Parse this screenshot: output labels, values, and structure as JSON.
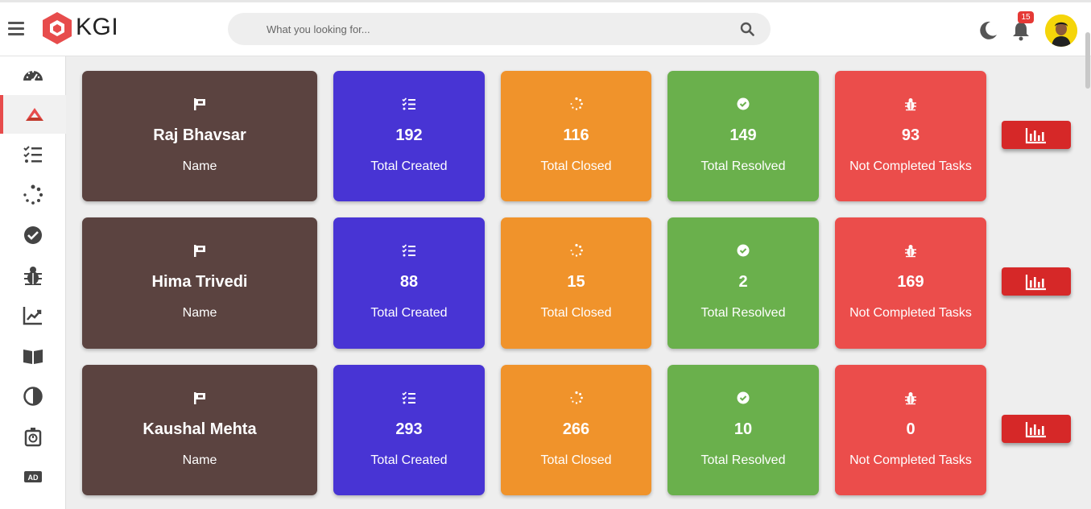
{
  "app": {
    "logo_text": "KGI"
  },
  "search": {
    "placeholder": "What you looking for..."
  },
  "header": {
    "notification_count": "15"
  },
  "sidebar": {
    "items": [
      {
        "icon": "speedometer-icon"
      },
      {
        "icon": "logo-mark-icon",
        "active": true
      },
      {
        "icon": "task-list-icon"
      },
      {
        "icon": "spinner-icon"
      },
      {
        "icon": "check-circle-icon"
      },
      {
        "icon": "bug-icon"
      },
      {
        "icon": "trend-chart-icon"
      },
      {
        "icon": "book-icon"
      },
      {
        "icon": "contrast-icon"
      },
      {
        "icon": "timer-icon"
      },
      {
        "icon": "ad-icon"
      }
    ]
  },
  "colors": {
    "name_card": "#5b4340",
    "created_card": "#4834d4",
    "closed_card": "#f0932b",
    "resolved_card": "#6ab04c",
    "not_completed_card": "#eb4d4b",
    "report_button": "#d62828",
    "accent": "#e74c4c"
  },
  "rows": [
    {
      "name": "Raj Bhavsar",
      "name_label": "Name",
      "created": "192",
      "created_label": "Total Created",
      "closed": "116",
      "closed_label": "Total Closed",
      "resolved": "149",
      "resolved_label": "Total Resolved",
      "not_completed": "93",
      "not_completed_label": "Not Completed Tasks"
    },
    {
      "name": "Hima Trivedi",
      "name_label": "Name",
      "created": "88",
      "created_label": "Total Created",
      "closed": "15",
      "closed_label": "Total Closed",
      "resolved": "2",
      "resolved_label": "Total Resolved",
      "not_completed": "169",
      "not_completed_label": "Not Completed Tasks"
    },
    {
      "name": "Kaushal Mehta",
      "name_label": "Name",
      "created": "293",
      "created_label": "Total Created",
      "closed": "266",
      "closed_label": "Total Closed",
      "resolved": "10",
      "resolved_label": "Total Resolved",
      "not_completed": "0",
      "not_completed_label": "Not Completed Tasks"
    }
  ]
}
